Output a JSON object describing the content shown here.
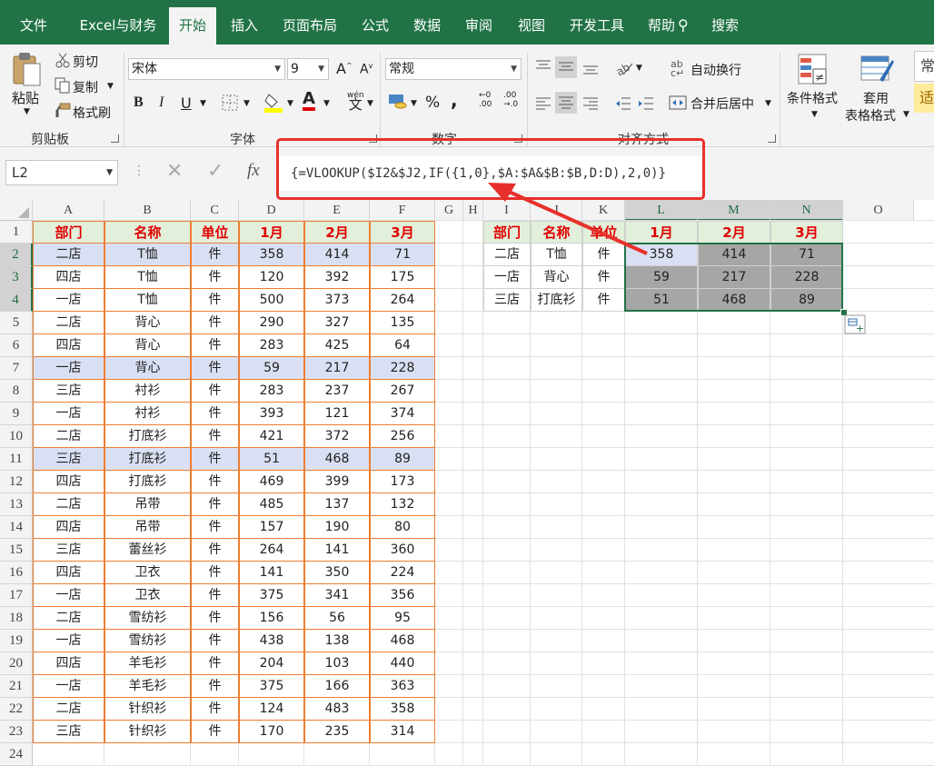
{
  "ribbon_tabs": [
    "文件",
    "Excel与财务",
    "开始",
    "插入",
    "页面布局",
    "公式",
    "数据",
    "审阅",
    "视图",
    "开发工具",
    "帮助",
    "搜索"
  ],
  "active_tab": "开始",
  "clipboard": {
    "paste": "粘贴",
    "cut": "剪切",
    "copy": "复制",
    "format_painter": "格式刷",
    "group": "剪贴板"
  },
  "font": {
    "name": "宋体",
    "size": "9",
    "group": "字体",
    "bold": "B",
    "italic": "I",
    "underline": "U",
    "increase": "A",
    "decrease": "A",
    "phonetic": "wén"
  },
  "number": {
    "format": "常规",
    "group": "数字",
    "percent": "%",
    "comma": ","
  },
  "alignment": {
    "wrap": "自动换行",
    "merge": "合并后居中",
    "group": "对齐方式"
  },
  "styles": {
    "conditional": "条件格式",
    "table_line1": "套用",
    "table_line2": "表格格式",
    "cell_style_partial": "常",
    "cell_style_partial2": "适"
  },
  "name_box": "L2",
  "formula": "{=VLOOKUP($I2&$J2,IF({1,0},$A:$A&$B:$B,D:D),2,0)}",
  "fx": "fx",
  "columns": [
    "A",
    "B",
    "C",
    "D",
    "E",
    "F",
    "G",
    "H",
    "I",
    "J",
    "K",
    "L",
    "M",
    "N",
    "O"
  ],
  "rows": [
    "1",
    "2",
    "3",
    "4",
    "5",
    "6",
    "7",
    "8",
    "9",
    "10",
    "11",
    "12",
    "13",
    "14",
    "15",
    "16",
    "17",
    "18",
    "19",
    "20",
    "21",
    "22",
    "23",
    "24"
  ],
  "source_headers": [
    "部门",
    "名称",
    "单位",
    "1月",
    "2月",
    "3月"
  ],
  "source_rows": [
    [
      "二店",
      "T恤",
      "件",
      "358",
      "414",
      "71"
    ],
    [
      "四店",
      "T恤",
      "件",
      "120",
      "392",
      "175"
    ],
    [
      "一店",
      "T恤",
      "件",
      "500",
      "373",
      "264"
    ],
    [
      "二店",
      "背心",
      "件",
      "290",
      "327",
      "135"
    ],
    [
      "四店",
      "背心",
      "件",
      "283",
      "425",
      "64"
    ],
    [
      "一店",
      "背心",
      "件",
      "59",
      "217",
      "228"
    ],
    [
      "三店",
      "衬衫",
      "件",
      "283",
      "237",
      "267"
    ],
    [
      "一店",
      "衬衫",
      "件",
      "393",
      "121",
      "374"
    ],
    [
      "二店",
      "打底衫",
      "件",
      "421",
      "372",
      "256"
    ],
    [
      "三店",
      "打底衫",
      "件",
      "51",
      "468",
      "89"
    ],
    [
      "四店",
      "打底衫",
      "件",
      "469",
      "399",
      "173"
    ],
    [
      "二店",
      "吊带",
      "件",
      "485",
      "137",
      "132"
    ],
    [
      "四店",
      "吊带",
      "件",
      "157",
      "190",
      "80"
    ],
    [
      "三店",
      "蕾丝衫",
      "件",
      "264",
      "141",
      "360"
    ],
    [
      "四店",
      "卫衣",
      "件",
      "141",
      "350",
      "224"
    ],
    [
      "一店",
      "卫衣",
      "件",
      "375",
      "341",
      "356"
    ],
    [
      "二店",
      "雪纺衫",
      "件",
      "156",
      "56",
      "95"
    ],
    [
      "一店",
      "雪纺衫",
      "件",
      "438",
      "138",
      "468"
    ],
    [
      "四店",
      "羊毛衫",
      "件",
      "204",
      "103",
      "440"
    ],
    [
      "一店",
      "羊毛衫",
      "件",
      "375",
      "166",
      "363"
    ],
    [
      "二店",
      "针织衫",
      "件",
      "124",
      "483",
      "358"
    ],
    [
      "三店",
      "针织衫",
      "件",
      "170",
      "235",
      "314"
    ]
  ],
  "highlighted_source_rows": [
    0,
    5,
    9
  ],
  "lookup_headers": [
    "部门",
    "名称",
    "单位",
    "1月",
    "2月",
    "3月"
  ],
  "lookup_rows": [
    [
      "二店",
      "T恤",
      "件",
      "358",
      "414",
      "71"
    ],
    [
      "一店",
      "背心",
      "件",
      "59",
      "217",
      "228"
    ],
    [
      "三店",
      "打底衫",
      "件",
      "51",
      "468",
      "89"
    ]
  ],
  "colors": {
    "ribbon_green": "#217346",
    "header_red": "#e00000",
    "header_fill": "#e2efda",
    "highlight_fill": "#dae0f3",
    "selection_fill": "#a6a6a6",
    "annotation_red": "#e8302b",
    "cell_border": "#ed7d31"
  }
}
